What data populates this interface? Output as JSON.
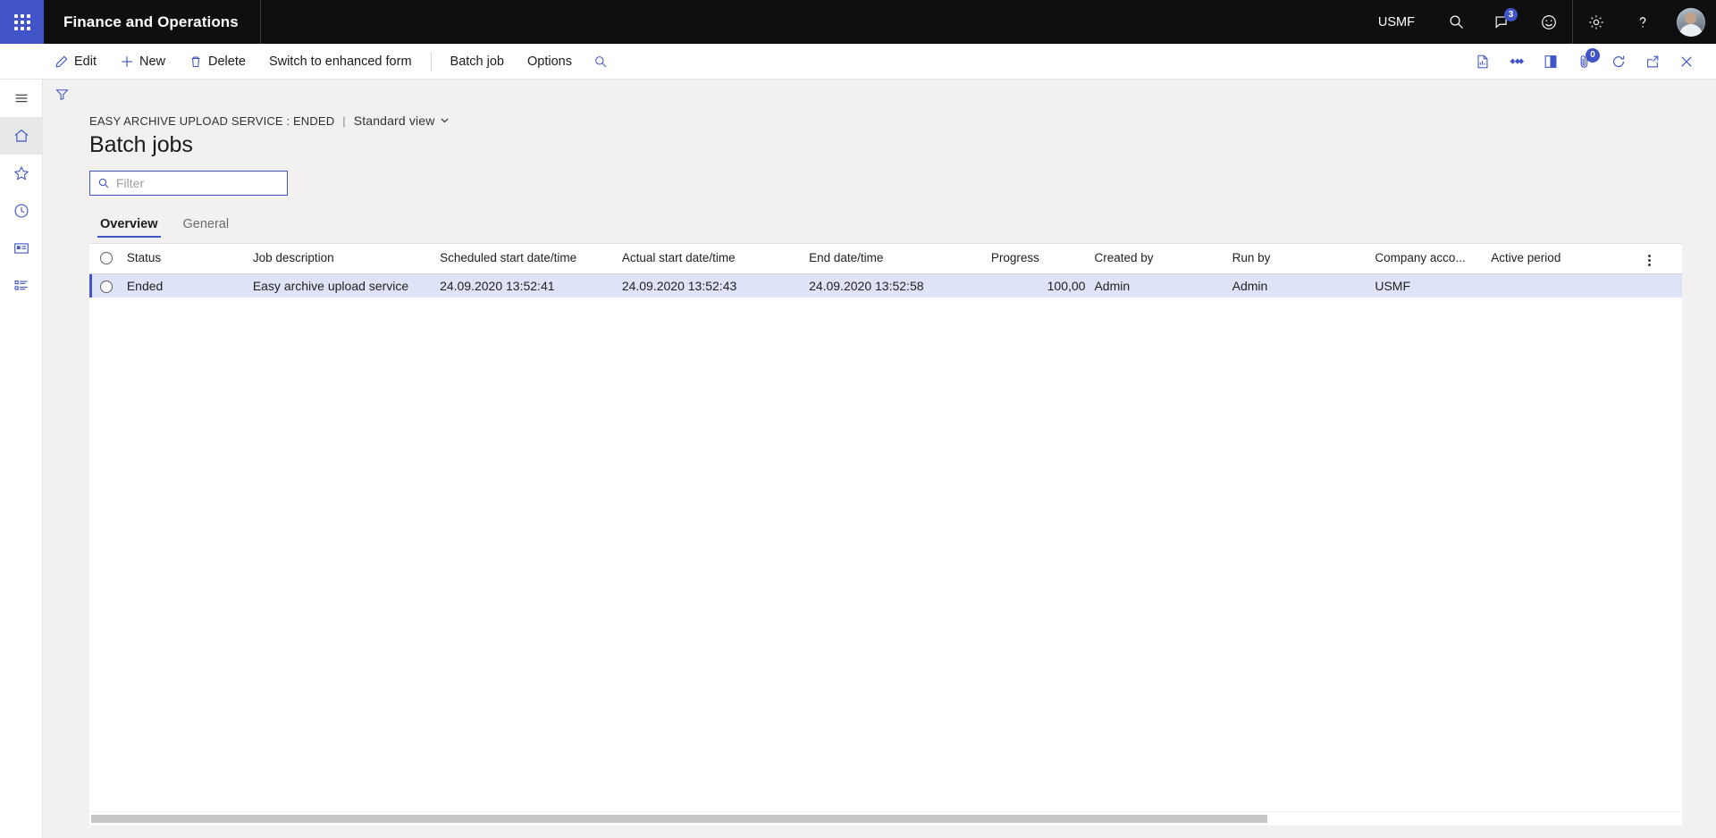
{
  "topbar": {
    "waffle_label": "app-launcher",
    "app_title": "Finance and Operations",
    "company": "USMF",
    "search_icon": "search-icon",
    "notifications_icon": "notifications-icon",
    "notifications_count": "3",
    "feedback_icon": "feedback-smiley-icon",
    "settings_icon": "gear-icon",
    "help_icon": "help-question-icon",
    "avatar_alt": "user-avatar"
  },
  "commandbar": {
    "buttons": [
      {
        "label": "Edit",
        "icon": "pencil-icon"
      },
      {
        "label": "New",
        "icon": "plus-icon"
      },
      {
        "label": "Delete",
        "icon": "trash-icon"
      },
      {
        "label": "Switch to enhanced form",
        "icon": ""
      }
    ],
    "menus": [
      {
        "label": "Batch job"
      },
      {
        "label": "Options"
      }
    ],
    "search_icon": "search-icon",
    "right_icons": [
      {
        "name": "report-document-icon",
        "badge": ""
      },
      {
        "name": "relations-diamonds-icon",
        "badge": ""
      },
      {
        "name": "side-panel-icon",
        "badge": ""
      },
      {
        "name": "attachments-icon",
        "badge": "0"
      },
      {
        "name": "refresh-icon",
        "badge": ""
      },
      {
        "name": "open-in-new-window-icon",
        "badge": ""
      },
      {
        "name": "close-icon",
        "badge": ""
      }
    ]
  },
  "leftnav": {
    "items": [
      {
        "name": "hamburger-menu-icon",
        "active": false
      },
      {
        "name": "home-icon",
        "active": true
      },
      {
        "name": "favorites-star-icon",
        "active": false
      },
      {
        "name": "recent-clock-icon",
        "active": false
      },
      {
        "name": "workspaces-icon",
        "active": false
      },
      {
        "name": "modules-list-icon",
        "active": false
      }
    ]
  },
  "page": {
    "filter_funnel_icon": "filter-funnel-icon",
    "breadcrumb_caption": "EASY ARCHIVE UPLOAD SERVICE : ENDED",
    "breadcrumb_separator": "|",
    "view_selector": "Standard view",
    "title": "Batch jobs",
    "filter": {
      "value": "",
      "placeholder": "Filter",
      "icon": "search-icon"
    },
    "tabs": [
      {
        "label": "Overview",
        "active": true
      },
      {
        "label": "General",
        "active": false
      }
    ]
  },
  "grid": {
    "columns": [
      "Status",
      "Job description",
      "Scheduled start date/time",
      "Actual start date/time",
      "End date/time",
      "Progress",
      "Created by",
      "Run by",
      "Company acco...",
      "Active period"
    ],
    "rows": [
      {
        "status": "Ended",
        "job_description": "Easy archive upload service",
        "scheduled_start": "24.09.2020 13:52:41",
        "actual_start": "24.09.2020 13:52:43",
        "end_datetime": "24.09.2020 13:52:58",
        "progress": "100,00",
        "created_by": "Admin",
        "run_by": "Admin",
        "company_account": "USMF",
        "active_period": ""
      }
    ],
    "column_options_icon": "column-options-kebab-icon"
  },
  "colors": {
    "accent": "#4154c7",
    "selected_row": "#dfe3f7",
    "topbar": "#0f0f0f",
    "page_bg": "#f2f1f0"
  }
}
